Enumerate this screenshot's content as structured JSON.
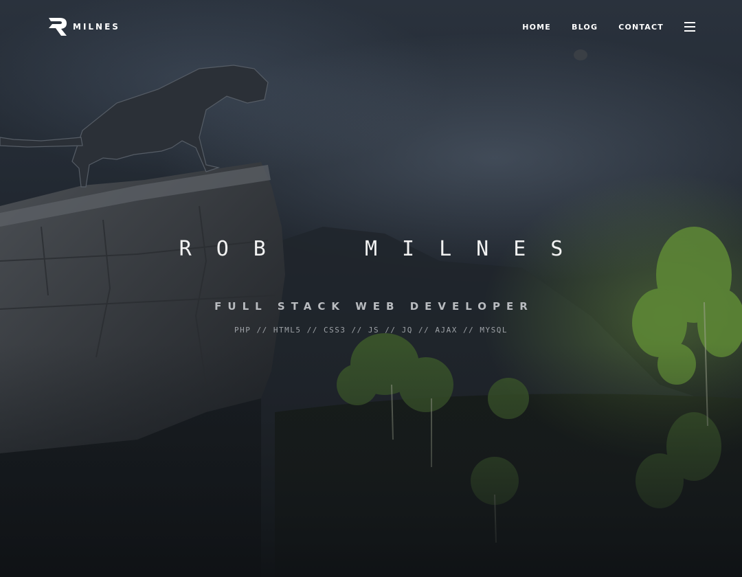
{
  "brand": {
    "name": "MILNES"
  },
  "nav": {
    "items": [
      {
        "label": "HOME"
      },
      {
        "label": "BLOG"
      },
      {
        "label": "CONTACT"
      }
    ],
    "menu_icon": "hamburger-icon"
  },
  "hero": {
    "name": "ROB  MILNES",
    "role": "FULL STACK WEB DEVELOPER",
    "skills": "PHP // HTML5 // CSS3 // JS // JQ // AJAX // MYSQL"
  },
  "colors": {
    "text": "#ffffff",
    "subtext": "#b9bcc0",
    "background": "#1b2027",
    "foliage": "#6f9a3e"
  }
}
